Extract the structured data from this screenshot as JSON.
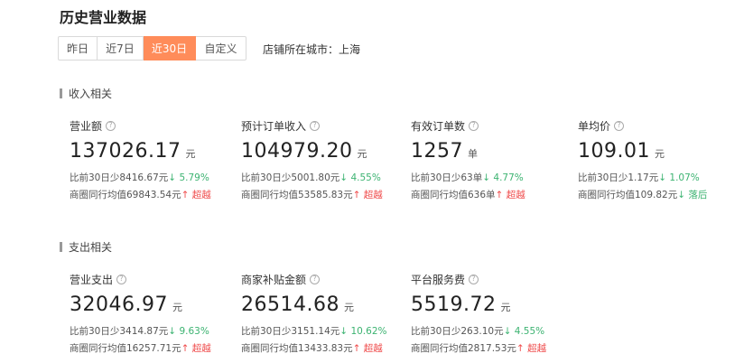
{
  "page": {
    "title": "历史营业数据"
  },
  "range_tabs": [
    {
      "label": "昨日",
      "active": false
    },
    {
      "label": "近7日",
      "active": false
    },
    {
      "label": "近30日",
      "active": true
    },
    {
      "label": "自定义",
      "active": false
    }
  ],
  "city_text": "店铺所在城市：上海",
  "icons": {
    "help": "help-circle-icon",
    "down_arrow": "↓",
    "up_arrow": "↑"
  },
  "colors": {
    "accent": "#ff8c5a",
    "decrease": "#3cb371",
    "increase": "#ef4b4b"
  },
  "income": {
    "title": "收入相关",
    "metrics": [
      {
        "label": "营业额",
        "value": "137026.17",
        "unit": "元",
        "compare": "比前30日少8416.67元",
        "compare_arrow": "↓",
        "compare_pct": "5.79%",
        "peer": "商圈同行均值69843.54元",
        "peer_arrow": "↑",
        "peer_status": "超越"
      },
      {
        "label": "预计订单收入",
        "value": "104979.20",
        "unit": "元",
        "compare": "比前30日少5001.80元",
        "compare_arrow": "↓",
        "compare_pct": "4.55%",
        "peer": "商圈同行均值53585.83元",
        "peer_arrow": "↑",
        "peer_status": "超越"
      },
      {
        "label": "有效订单数",
        "value": "1257",
        "unit": "单",
        "compare": "比前30日少63单",
        "compare_arrow": "↓",
        "compare_pct": "4.77%",
        "peer": "商圈同行均值636单",
        "peer_arrow": "↑",
        "peer_status": "超越"
      },
      {
        "label": "单均价",
        "value": "109.01",
        "unit": "元",
        "compare": "比前30日少1.17元",
        "compare_arrow": "↓",
        "compare_pct": "1.07%",
        "peer": "商圈同行均值109.82元",
        "peer_arrow": "↓",
        "peer_status": "落后"
      }
    ]
  },
  "expense": {
    "title": "支出相关",
    "metrics": [
      {
        "label": "营业支出",
        "value": "32046.97",
        "unit": "元",
        "compare": "比前30日少3414.87元",
        "compare_arrow": "↓",
        "compare_pct": "9.63%",
        "peer": "商圈同行均值16257.71元",
        "peer_arrow": "↑",
        "peer_status": "超越"
      },
      {
        "label": "商家补贴金额",
        "value": "26514.68",
        "unit": "元",
        "compare": "比前30日少3151.14元",
        "compare_arrow": "↓",
        "compare_pct": "10.62%",
        "peer": "商圈同行均值13433.83元",
        "peer_arrow": "↑",
        "peer_status": "超越"
      },
      {
        "label": "平台服务费",
        "value": "5519.72",
        "unit": "元",
        "compare": "比前30日少263.10元",
        "compare_arrow": "↓",
        "compare_pct": "4.55%",
        "peer": "商圈同行均值2817.53元",
        "peer_arrow": "↑",
        "peer_status": "超越"
      }
    ]
  }
}
